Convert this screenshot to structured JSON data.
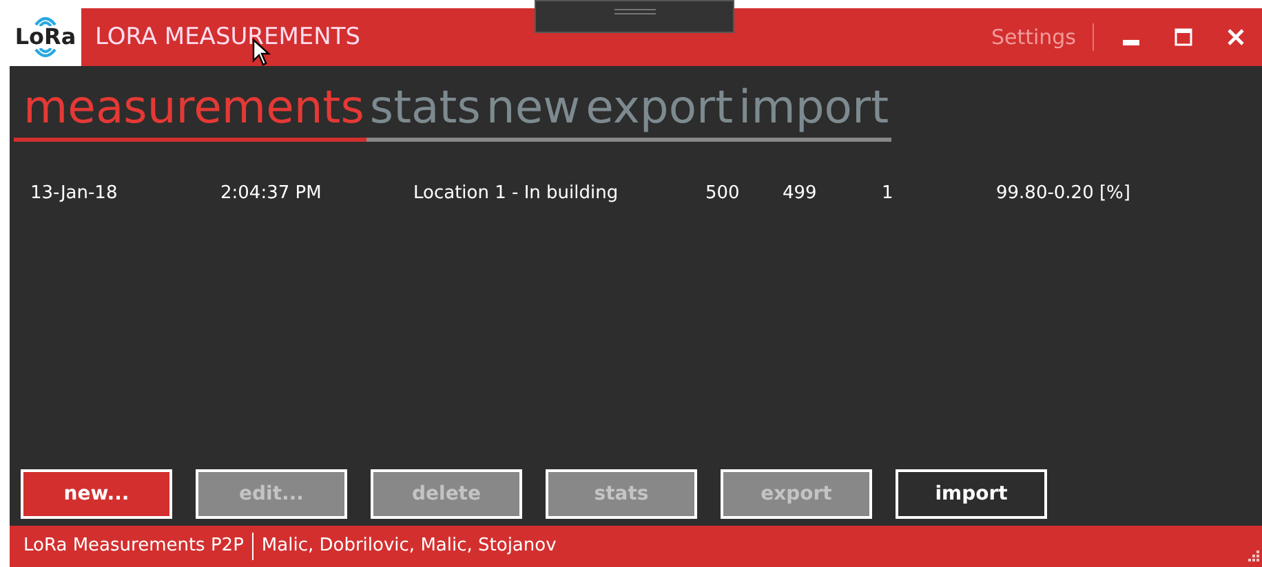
{
  "window": {
    "title": "LORA MEASUREMENTS",
    "logo": "LoRa",
    "settings": "Settings"
  },
  "tabs": [
    {
      "label": "measurements",
      "selected": true
    },
    {
      "label": "stats",
      "selected": false
    },
    {
      "label": "new",
      "selected": false
    },
    {
      "label": "export",
      "selected": false
    },
    {
      "label": "import",
      "selected": false
    }
  ],
  "rows": [
    {
      "cells": [
        "13-Jan-18",
        "2:04:37 PM",
        "Location 1 - In building",
        "500",
        "499",
        "1",
        "99.80-0.20 [%]"
      ]
    }
  ],
  "buttons": [
    {
      "label": "new...",
      "kind": "primary"
    },
    {
      "label": "edit...",
      "kind": "disabled"
    },
    {
      "label": "delete",
      "kind": "disabled"
    },
    {
      "label": "stats",
      "kind": "disabled"
    },
    {
      "label": "export",
      "kind": "disabled"
    },
    {
      "label": "import",
      "kind": "normal"
    }
  ],
  "status_bar": [
    "LoRa Measurements P2P",
    "Malic, Dobrilovic, Malic, Stojanov"
  ]
}
